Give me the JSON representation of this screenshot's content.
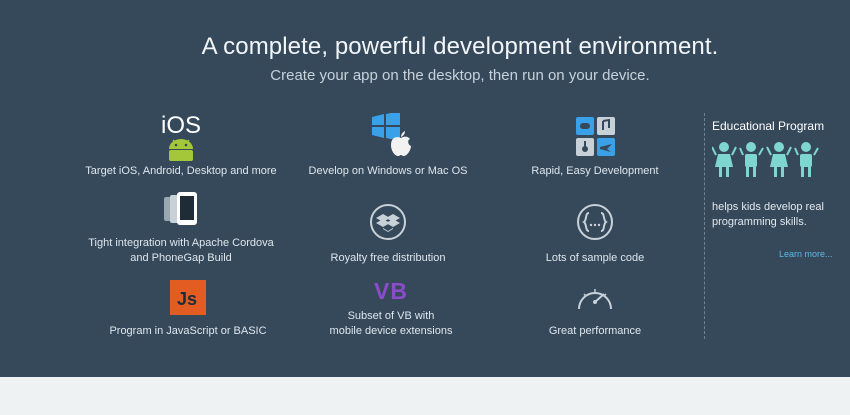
{
  "hero": {
    "headline": "A complete, powerful development environment.",
    "subhead": "Create your app on the desktop, then run on your device."
  },
  "features": [
    {
      "id": "targets",
      "icon": "ios-android-icon",
      "icon_text": "iOS",
      "label": "Target iOS, Android, Desktop and more"
    },
    {
      "id": "platforms",
      "icon": "windows-apple-icon",
      "label": "Develop on Windows or Mac OS"
    },
    {
      "id": "rapid",
      "icon": "apps-grid-icon",
      "label": "Rapid, Easy Development"
    },
    {
      "id": "cordova",
      "icon": "device-icon",
      "label_lines": [
        "Tight integration with Apache Cordova",
        "and PhoneGap Build"
      ]
    },
    {
      "id": "royalty",
      "icon": "dropbox-icon",
      "label": "Royalty free distribution"
    },
    {
      "id": "samples",
      "icon": "code-braces-icon",
      "label": "Lots of sample code"
    },
    {
      "id": "js",
      "icon": "javascript-icon",
      "icon_text": "Js",
      "label": "Program in JavaScript or BASIC"
    },
    {
      "id": "vb",
      "icon": "vb-icon",
      "icon_text": "VB",
      "label_lines": [
        "Subset of VB with",
        "mobile device extensions"
      ]
    },
    {
      "id": "performance",
      "icon": "speedometer-icon",
      "label": "Great performance"
    }
  ],
  "education": {
    "title": "Educational Program",
    "text": "helps kids develop real programming skills.",
    "link": "Learn more..."
  },
  "colors": {
    "hero_bg": "#36495b",
    "footer_bg": "#eef2f3",
    "android_green": "#a4c639",
    "windows_blue": "#3aa0e8",
    "js_orange": "#e35d22",
    "vb_purple": "#8a4cc9",
    "kids_teal": "#7fd6d0",
    "link_blue": "#59b8e6"
  }
}
